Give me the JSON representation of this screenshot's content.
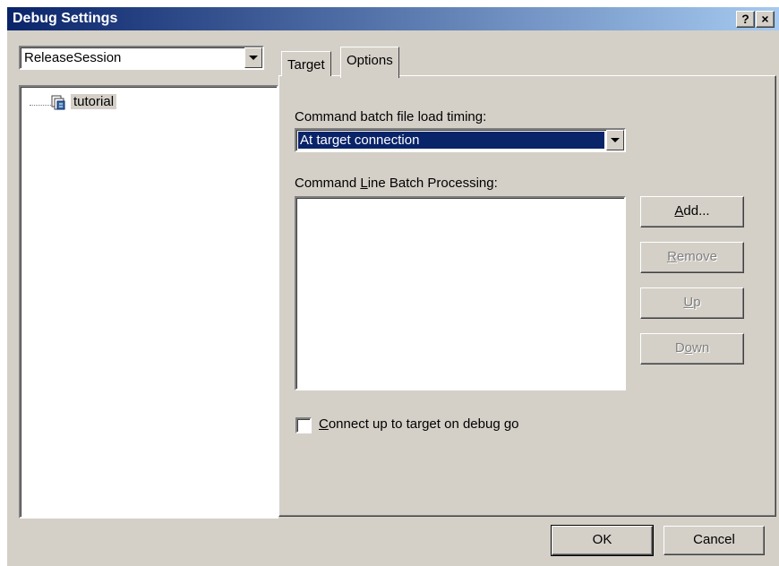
{
  "window": {
    "title": "Debug Settings",
    "help_label": "?",
    "close_label": "×"
  },
  "session": {
    "selected": "ReleaseSession"
  },
  "tree": {
    "items": [
      {
        "label": "tutorial"
      }
    ]
  },
  "tabs": [
    {
      "label": "Target"
    },
    {
      "label": "Options"
    }
  ],
  "options": {
    "timing_label": "Command batch file load timing:",
    "timing_value": "At target connection",
    "batch_label_pre": "Command ",
    "batch_label_key": "L",
    "batch_label_post": "ine Batch Processing:",
    "add_key": "A",
    "add_rest": "dd...",
    "remove_key": "R",
    "remove_rest": "emove",
    "up_key": "U",
    "up_rest": "p",
    "down_pre": "D",
    "down_key": "o",
    "down_rest": "wn",
    "connect_key": "C",
    "connect_rest": "onnect up to target on debug go"
  },
  "footer": {
    "ok_label": "OK",
    "cancel_label": "Cancel"
  },
  "colors": {
    "titlebar_start": "#0a246a",
    "titlebar_end": "#a6caf0",
    "selection": "#0a246a",
    "face": "#d4d0c8"
  }
}
